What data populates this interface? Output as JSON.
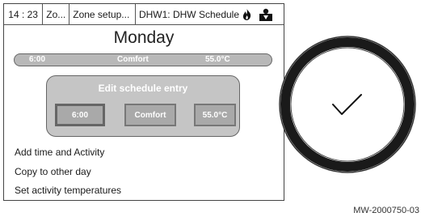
{
  "status_bar": {
    "time": "14 : 23",
    "crumb_1": "Zo...",
    "crumb_2": "Zone setup...",
    "crumb_3": "DHW1: DHW Schedule",
    "icons": [
      "flame-icon",
      "user-icon"
    ]
  },
  "day_title": "Monday",
  "selected_entry": {
    "time": "6:00",
    "activity": "Comfort",
    "temperature": "55.0°C"
  },
  "edit_panel": {
    "title": "Edit schedule entry",
    "time": "6:00",
    "activity": "Comfort",
    "temperature": "55.0°C"
  },
  "menu": [
    {
      "label": "Add time and Activity"
    },
    {
      "label": "Copy to other day"
    },
    {
      "label": "Set activity temperatures"
    }
  ],
  "knob": {
    "icon": "checkmark-icon"
  },
  "caption": "MW-2000750-03"
}
